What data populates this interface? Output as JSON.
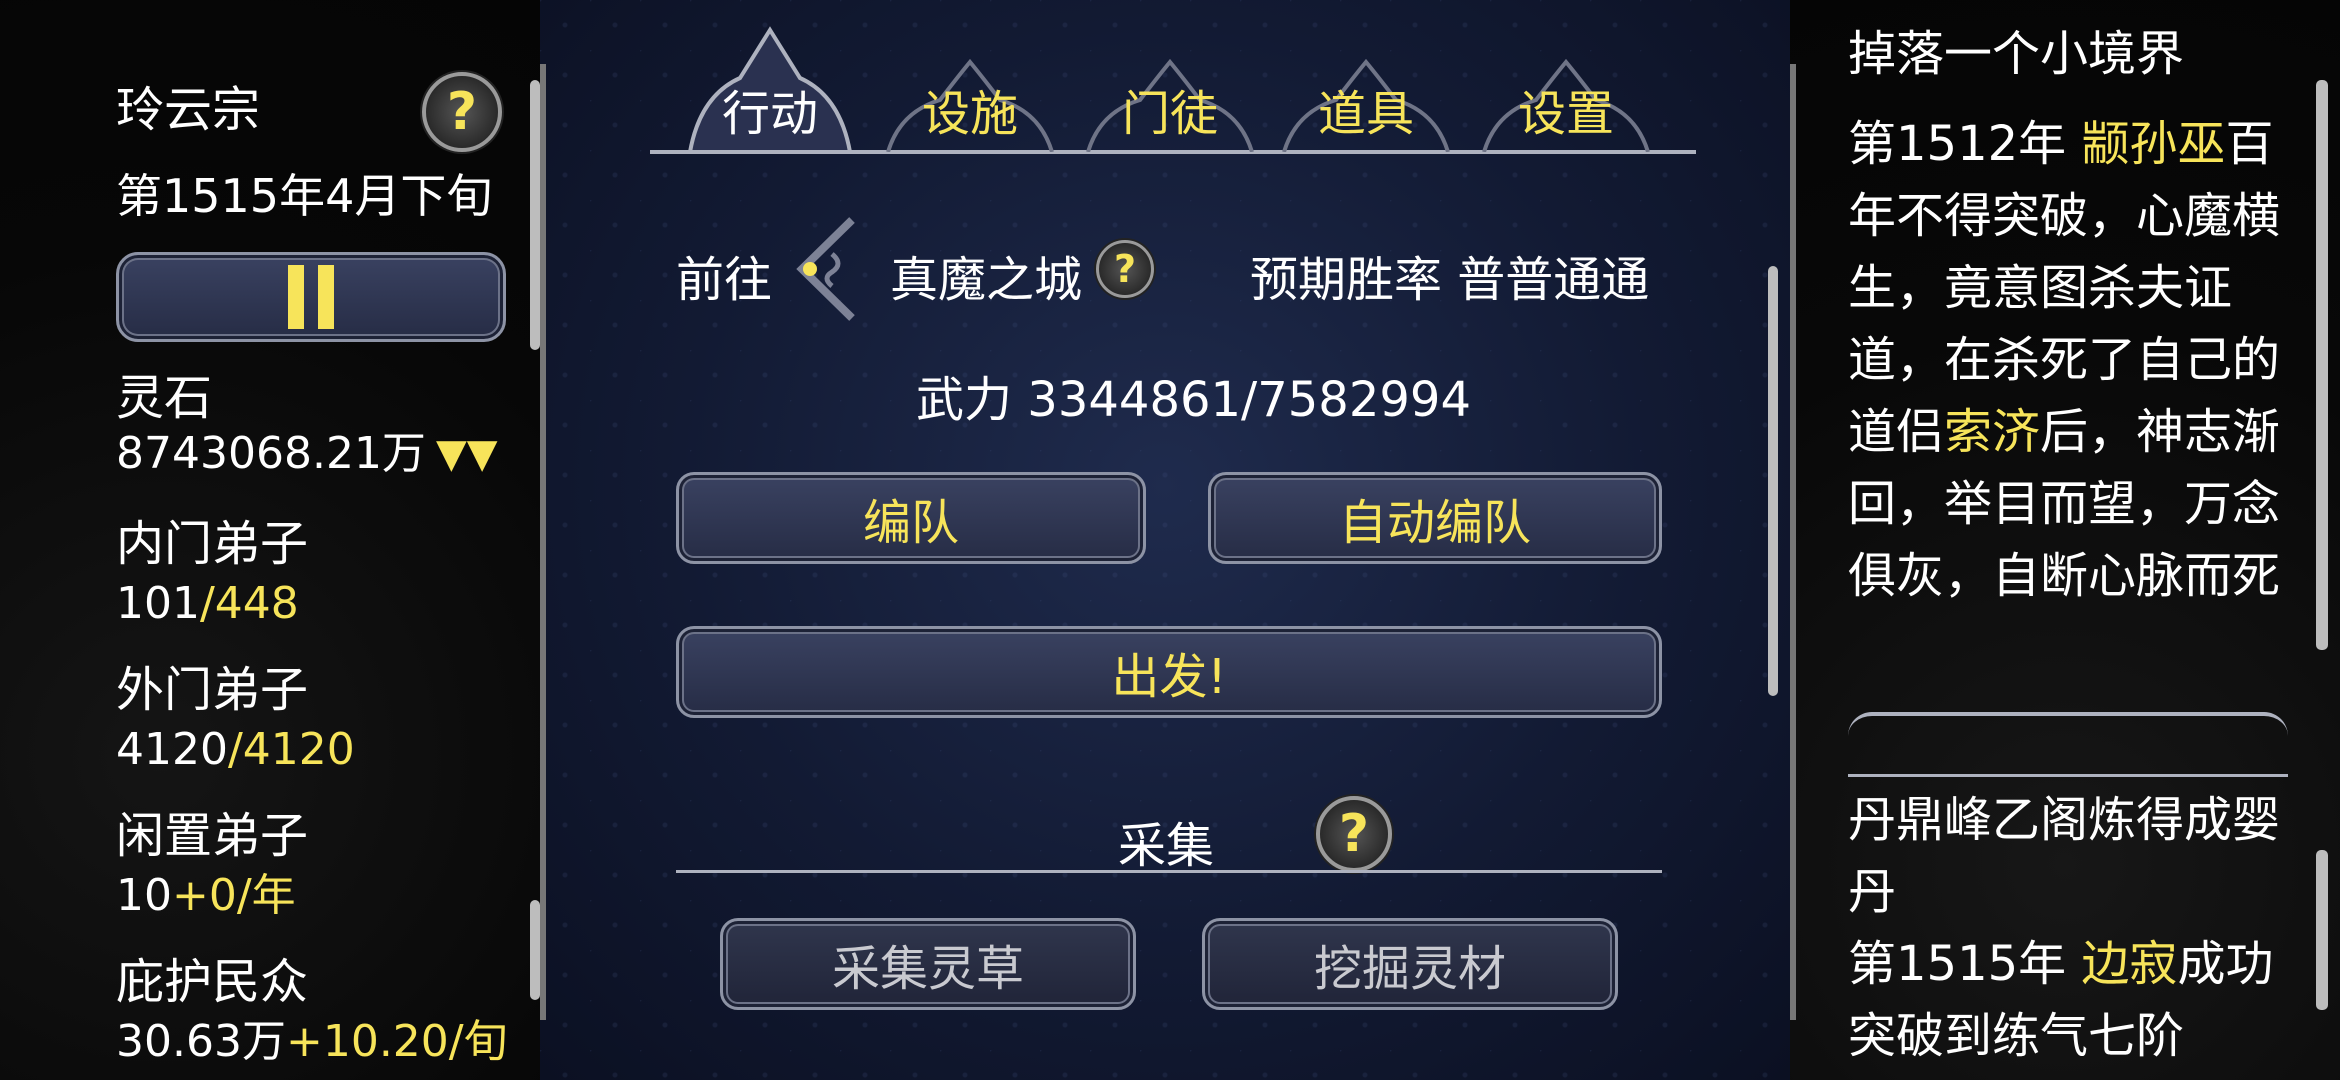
{
  "sect": {
    "name": "玲云宗",
    "date": "第1515年4月下旬",
    "pause_icon": "pause-icon",
    "help_icon": "question-mark-icon"
  },
  "stats": {
    "spirit_stone_label": "灵石",
    "spirit_stone_value": "8743068.21万",
    "spirit_stone_trend": "▼▼",
    "inner_label": "内门弟子",
    "inner_current": "101",
    "inner_max": "/448",
    "outer_label": "外门弟子",
    "outer_current": "4120",
    "outer_max": "/4120",
    "idle_label": "闲置弟子",
    "idle_current": "10",
    "idle_rate": "+0/年",
    "protected_label": "庇护民众",
    "protected_current": "30.63万",
    "protected_rate": "+10.20/旬"
  },
  "tabs": [
    "行动",
    "设施",
    "门徒",
    "道具",
    "设置"
  ],
  "action": {
    "goto_label": "前往",
    "destination": "真魔之城",
    "win_rate_label": "预期胜率",
    "win_rate_value": "普普通通",
    "power_label": "武力",
    "power_value": "3344861/7582994",
    "formation_button": "编队",
    "auto_formation_button": "自动编队",
    "depart_button": "出发!",
    "gather_title": "采集",
    "gather_herbs_button": "采集灵草",
    "mine_materials_button": "挖掘灵材"
  },
  "log": {
    "top_partial": "掉落一个小境界",
    "entry1_year": "第1512年 ",
    "entry1_name": "颛孙巫",
    "entry1_text_a": "百年不得突破，心魔横生，竟意图杀夫证道，在杀死了自己的道侣",
    "entry1_name2": "索济",
    "entry1_text_b": "后，神志渐回，举目而望，万念俱灰，自断心脉而死",
    "entry2": "丹鼎峰乙阁炼得成婴丹",
    "entry3_year": "第1515年 ",
    "entry3_name": "边寂",
    "entry3_text": "成功突破到练气七阶"
  },
  "colors": {
    "accent_yellow": "#f7e45a",
    "text_white": "#ffffff",
    "center_bg": "#1a2442",
    "button_border": "#8d93a5"
  }
}
